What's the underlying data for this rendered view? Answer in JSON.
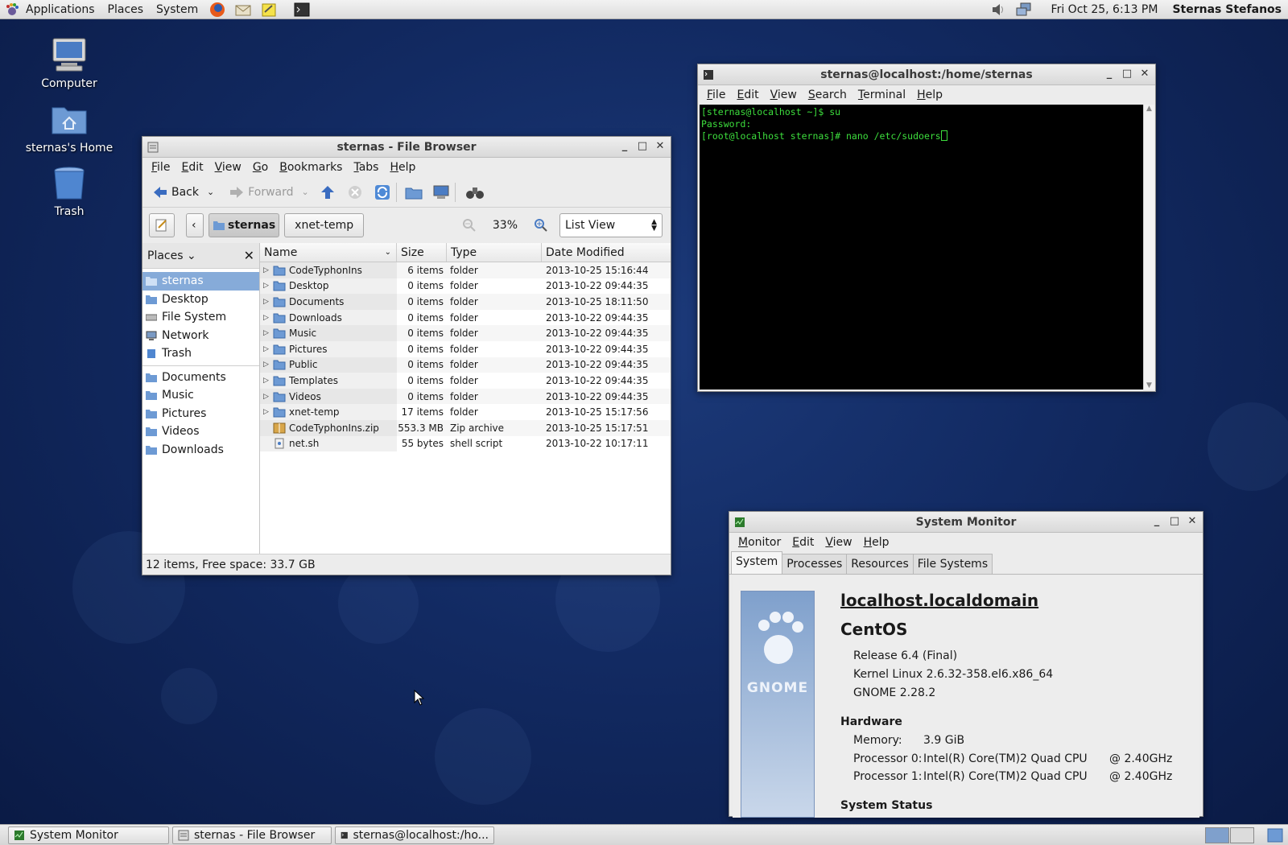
{
  "top_panel": {
    "menus": [
      "Applications",
      "Places",
      "System"
    ],
    "clock": "Fri Oct 25,  6:13 PM",
    "user": "Sternas Stefanos"
  },
  "desktop": {
    "icons": [
      {
        "label": "Computer"
      },
      {
        "label": "sternas's Home"
      },
      {
        "label": "Trash"
      }
    ]
  },
  "file_browser": {
    "title": "sternas - File Browser",
    "menu": [
      "File",
      "Edit",
      "View",
      "Go",
      "Bookmarks",
      "Tabs",
      "Help"
    ],
    "toolbar": {
      "back": "Back",
      "forward": "Forward"
    },
    "path": [
      "sternas",
      "xnet-temp"
    ],
    "zoom": "33%",
    "view_mode": "List View",
    "sidebar": {
      "header": "Places",
      "items": [
        "sternas",
        "Desktop",
        "File System",
        "Network",
        "Trash"
      ],
      "bookmarks": [
        "Documents",
        "Music",
        "Pictures",
        "Videos",
        "Downloads"
      ]
    },
    "columns": [
      "Name",
      "Size",
      "Type",
      "Date Modified"
    ],
    "rows": [
      {
        "name": "CodeTyphonIns",
        "size": "6 items",
        "type": "folder",
        "date": "2013-10-25 15:16:44"
      },
      {
        "name": "Desktop",
        "size": "0 items",
        "type": "folder",
        "date": "2013-10-22 09:44:35"
      },
      {
        "name": "Documents",
        "size": "0 items",
        "type": "folder",
        "date": "2013-10-25 18:11:50"
      },
      {
        "name": "Downloads",
        "size": "0 items",
        "type": "folder",
        "date": "2013-10-22 09:44:35"
      },
      {
        "name": "Music",
        "size": "0 items",
        "type": "folder",
        "date": "2013-10-22 09:44:35"
      },
      {
        "name": "Pictures",
        "size": "0 items",
        "type": "folder",
        "date": "2013-10-22 09:44:35"
      },
      {
        "name": "Public",
        "size": "0 items",
        "type": "folder",
        "date": "2013-10-22 09:44:35"
      },
      {
        "name": "Templates",
        "size": "0 items",
        "type": "folder",
        "date": "2013-10-22 09:44:35"
      },
      {
        "name": "Videos",
        "size": "0 items",
        "type": "folder",
        "date": "2013-10-22 09:44:35"
      },
      {
        "name": "xnet-temp",
        "size": "17 items",
        "type": "folder",
        "date": "2013-10-25 15:17:56"
      },
      {
        "name": "CodeTyphonIns.zip",
        "size": "553.3 MB",
        "type": "Zip archive",
        "date": "2013-10-25 15:17:51"
      },
      {
        "name": "net.sh",
        "size": "55 bytes",
        "type": "shell script",
        "date": "2013-10-22 10:17:11"
      }
    ],
    "status": "12 items, Free space: 33.7 GB"
  },
  "terminal": {
    "title": "sternas@localhost:/home/sternas",
    "menu": [
      "File",
      "Edit",
      "View",
      "Search",
      "Terminal",
      "Help"
    ],
    "lines": [
      "[sternas@localhost ~]$ su",
      "Password:",
      "[root@localhost sternas]# nano /etc/sudoers"
    ]
  },
  "system_monitor": {
    "title": "System Monitor",
    "menu": [
      "Monitor",
      "Edit",
      "View",
      "Help"
    ],
    "tabs": [
      "System",
      "Processes",
      "Resources",
      "File Systems"
    ],
    "banner": "GNOME",
    "hostname": "localhost.localdomain",
    "os": "CentOS",
    "release": "Release 6.4 (Final)",
    "kernel": "Kernel Linux 2.6.32-358.el6.x86_64",
    "gnome": "GNOME 2.28.2",
    "hardware_header": "Hardware",
    "memory_label": "Memory:",
    "memory_value": "3.9 GiB",
    "proc0_label": "Processor 0:",
    "proc0_value": "Intel(R) Core(TM)2 Quad CPU",
    "proc0_speed": "@ 2.40GHz",
    "proc1_label": "Processor 1:",
    "proc1_value": "Intel(R) Core(TM)2 Quad CPU",
    "proc1_speed": "@ 2.40GHz",
    "status_header": "System Status"
  },
  "taskbar": {
    "tasks": [
      "System Monitor",
      "sternas - File Browser",
      "sternas@localhost:/ho..."
    ]
  },
  "colors": {
    "selection": "#86abd9",
    "terminal_text": "#3dde3d",
    "desktop_bg": "#122a62"
  }
}
